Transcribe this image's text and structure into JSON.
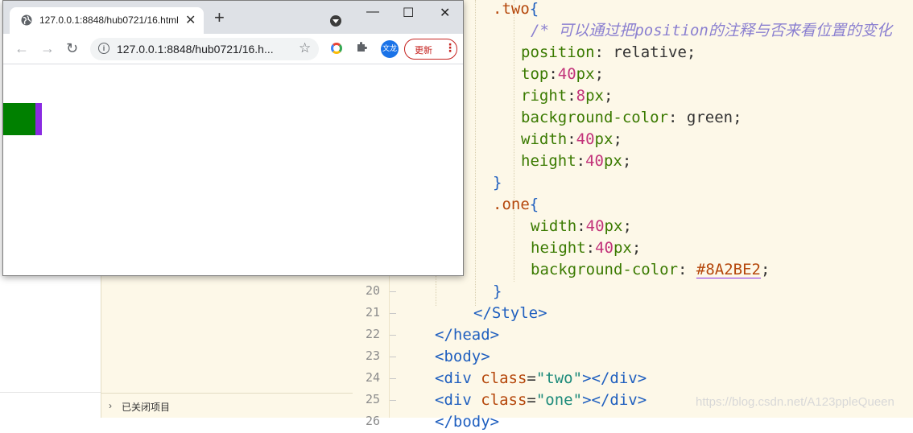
{
  "browser": {
    "tab_title": "127.0.0.1:8848/hub0721/16.html",
    "tab_close": "✕",
    "new_tab": "+",
    "url": "127.0.0.1:8848/hub0721/16.h...",
    "back": "←",
    "forward": "→",
    "reload": "↻",
    "info": "i",
    "star": "☆",
    "profile": "文龙",
    "update_label": "更新",
    "update_menu": "⋮",
    "win_min": "—",
    "win_max": "☐",
    "win_close": "✕",
    "two_color": "green",
    "one_color": "#8A2BE2"
  },
  "sidebar": {
    "closed_items_chevron": "›",
    "closed_items_label": "已关闭项目"
  },
  "line_numbers": [
    "20",
    "21",
    "22",
    "23",
    "24",
    "25",
    "26"
  ],
  "code": {
    "two_selector": ".two",
    "open_brace": "{",
    "close_brace": "}",
    "comment": "/* 可以通过把position的注释与否来看位置的变化",
    "position_prop": "position",
    "position_val": "relative",
    "top_prop": "top",
    "top_num": "40",
    "right_prop": "right",
    "right_num": "8",
    "bg_prop": "background-color",
    "bg_two_val": "green",
    "width_prop": "width",
    "width_num": "40",
    "height_prop": "height",
    "height_num": "40",
    "one_selector": ".one",
    "bg_one_val": "#8A2BE2",
    "px": "px",
    "colon": ":",
    "colon_sp": ": ",
    "semi": ";",
    "style_close": "</Style>",
    "head_close": "</head>",
    "body_open": "<body>",
    "div_open_lt": "<div ",
    "class_attr": "class",
    "eq": "=",
    "two_str": "\"two\"",
    "one_str": "\"one\"",
    "div_tail": "></div>",
    "body_close_partial": "</body>"
  },
  "watermark": "https://blog.csdn.net/A123ppleQueen"
}
